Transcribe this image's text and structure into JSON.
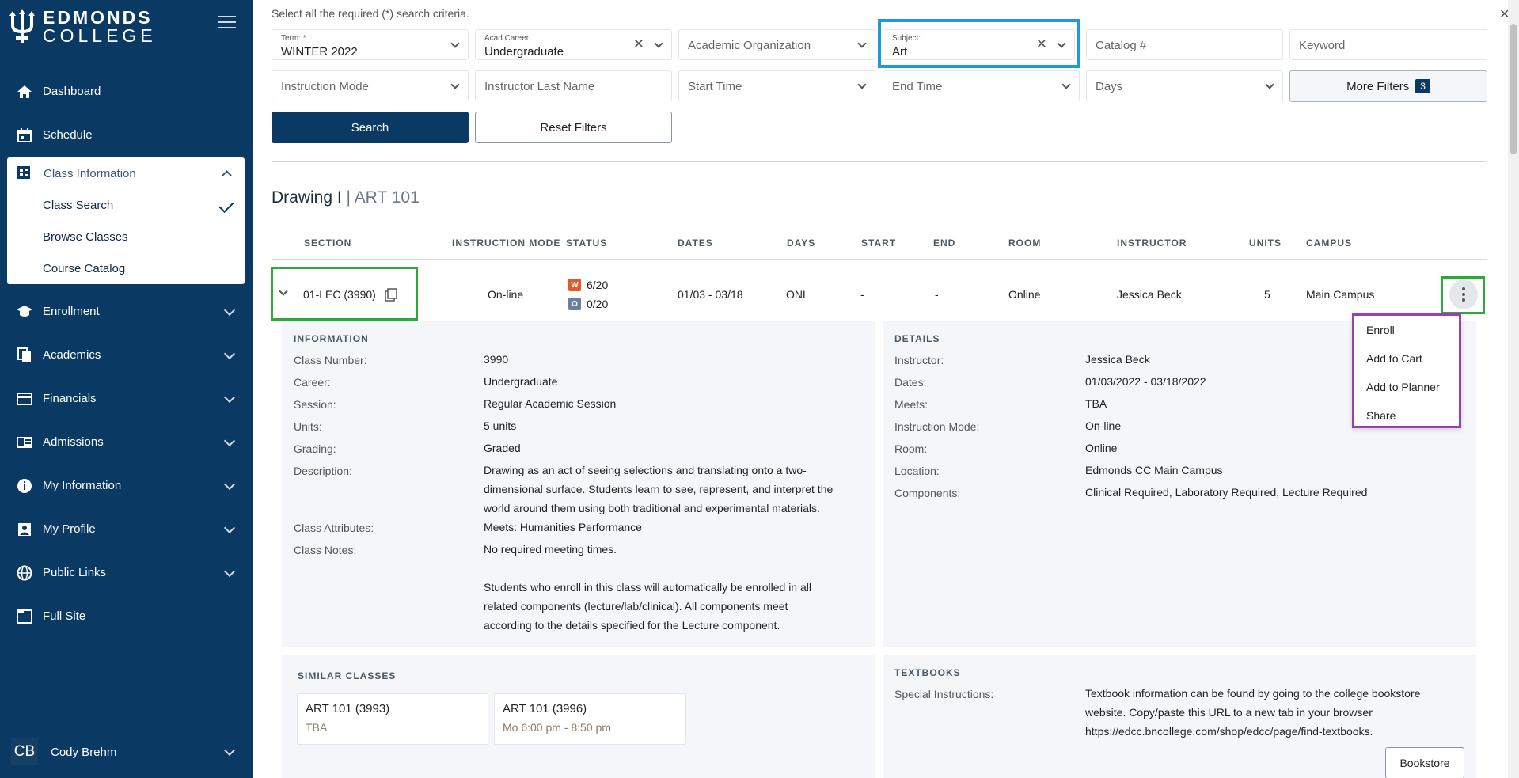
{
  "logo": {
    "line1": "EDMONDS",
    "line2": "COLLEGE"
  },
  "sidebar": {
    "items": [
      {
        "label": "Dashboard",
        "icon": "home-icon"
      },
      {
        "label": "Schedule",
        "icon": "calendar-icon"
      },
      {
        "label": "Enrollment",
        "icon": "graduation-cap-icon"
      },
      {
        "label": "Academics",
        "icon": "documents-icon"
      },
      {
        "label": "Financials",
        "icon": "credit-card-icon"
      },
      {
        "label": "Admissions",
        "icon": "id-card-icon"
      },
      {
        "label": "My Information",
        "icon": "info-icon"
      },
      {
        "label": "My Profile",
        "icon": "profile-icon"
      },
      {
        "label": "Public Links",
        "icon": "globe-icon"
      },
      {
        "label": "Full Site",
        "icon": "window-icon"
      }
    ],
    "group": {
      "label": "Class Information",
      "sub": [
        "Class Search",
        "Browse Classes",
        "Course Catalog"
      ]
    },
    "user": {
      "initials": "CB",
      "name": "Cody Brehm"
    }
  },
  "search": {
    "hint": "Select all the required (*) search criteria.",
    "term_label": "Term:",
    "term_required": "*",
    "term_value": "WINTER 2022",
    "career_label": "Acad Career:",
    "career_value": "Undergraduate",
    "org_placeholder": "Academic Organization",
    "subject_label": "Subject:",
    "subject_value": "Art",
    "catalog_placeholder": "Catalog #",
    "keyword_placeholder": "Keyword",
    "instruction_placeholder": "Instruction Mode",
    "instructor_placeholder": "Instructor Last Name",
    "start_placeholder": "Start Time",
    "end_placeholder": "End Time",
    "days_placeholder": "Days",
    "more_filters": "More Filters",
    "more_filters_count": "3",
    "search_btn": "Search",
    "reset_btn": "Reset Filters"
  },
  "course": {
    "title": "Drawing I",
    "separator": " | ",
    "code": "ART 101"
  },
  "table": {
    "headers": [
      "SECTION",
      "INSTRUCTION MODE",
      "STATUS",
      "DATES",
      "DAYS",
      "START",
      "END",
      "ROOM",
      "INSTRUCTOR",
      "UNITS",
      "CAMPUS"
    ],
    "row": {
      "section": "01-LEC (3990)",
      "mode": "On-line",
      "status_w_badge": "W",
      "status_w": "6/20",
      "status_o_badge": "O",
      "status_o": "0/20",
      "dates": "01/03 - 03/18",
      "days": "ONL",
      "start": "-",
      "end": "-",
      "room": "Online",
      "instructor": "Jessica Beck",
      "units": "5",
      "campus": "Main Campus"
    }
  },
  "menu": [
    "Enroll",
    "Add to Cart",
    "Add to Planner",
    "Share"
  ],
  "information": {
    "title": "INFORMATION",
    "class_number_label": "Class Number:",
    "class_number": "3990",
    "career_label": "Career:",
    "career": "Undergraduate",
    "session_label": "Session:",
    "session": "Regular Academic Session",
    "units_label": "Units:",
    "units": "5 units",
    "grading_label": "Grading:",
    "grading": "Graded",
    "description_label": "Description:",
    "description_1": "Drawing as an act of seeing selections and translating onto a two-",
    "description_2": "dimensional surface. Students learn to see, represent, and interpret the",
    "description_3": "world around them using both traditional and experimental materials.",
    "attributes_label": "Class Attributes:",
    "attributes": "Meets: Humanities Performance",
    "notes_label": "Class Notes:",
    "notes_1": "No required meeting times.",
    "notes_2": "Students who enroll in this class will automatically be enrolled in all",
    "notes_3": "related components (lecture/lab/clinical). All components meet",
    "notes_4": "according to the details specified for the Lecture component."
  },
  "details": {
    "title": "DETAILS",
    "instructor_label": "Instructor:",
    "instructor": "Jessica Beck",
    "dates_label": "Dates:",
    "dates": "01/03/2022 - 03/18/2022",
    "meets_label": "Meets:",
    "meets": "TBA",
    "mode_label": "Instruction Mode:",
    "mode": "On-line",
    "room_label": "Room:",
    "room": "Online",
    "location_label": "Location:",
    "location": "Edmonds CC Main Campus",
    "components_label": "Components:",
    "components": "Clinical Required, Laboratory Required, Lecture Required"
  },
  "similar": {
    "title": "SIMILAR CLASSES",
    "cards": [
      {
        "title": "ART 101 (3993)",
        "sub": "TBA"
      },
      {
        "title": "ART 101 (3996)",
        "sub": "Mo 6:00 pm - 8:50 pm"
      }
    ]
  },
  "textbooks": {
    "title": "TEXTBOOKS",
    "label": "Special Instructions:",
    "line1": "Textbook information can be found by going to the college bookstore",
    "line2": "website. Copy/paste this URL to a new tab in your browser",
    "line3": "https://edcc.bncollege.com/shop/edcc/page/find-textbooks.",
    "button": "Bookstore"
  },
  "colors": {
    "sidebar": "#0a3a64",
    "accent": "#0a3a64",
    "highlight_blue": "#1e9ad6",
    "highlight_green": "#2faa3a",
    "highlight_purple": "#9b3fb0",
    "status_w": "#e05a2a",
    "status_o": "#6a7fa3"
  }
}
